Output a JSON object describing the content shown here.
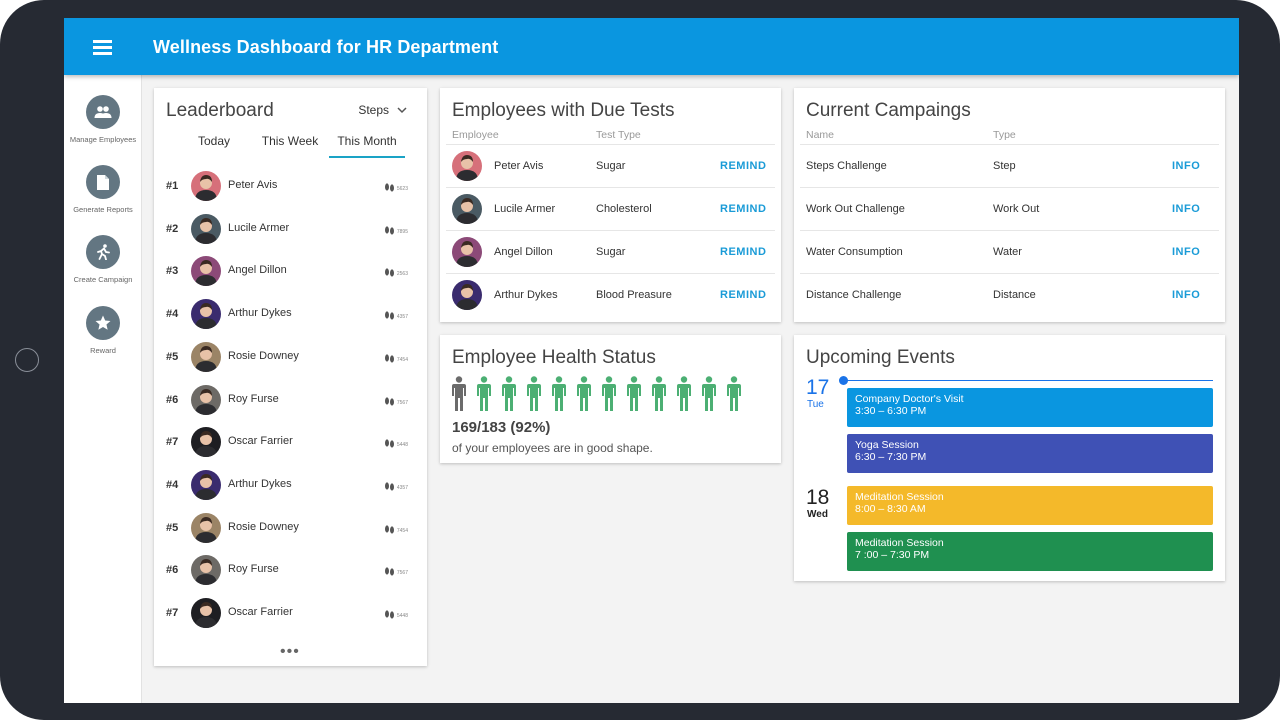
{
  "app": {
    "title": "Wellness Dashboard for HR Department"
  },
  "sidebar": {
    "items": [
      {
        "label": "Manage Employees",
        "icon": "people-icon"
      },
      {
        "label": "Generate Reports",
        "icon": "document-icon"
      },
      {
        "label": "Create Campaign",
        "icon": "running-icon"
      },
      {
        "label": "Reward",
        "icon": "star-icon"
      }
    ]
  },
  "leaderboard": {
    "title": "Leaderboard",
    "metric": "Steps",
    "tabs": [
      "Today",
      "This Week",
      "This Month"
    ],
    "active_tab": "This Month",
    "rows": [
      {
        "rank": "#1",
        "name": "Peter Avis",
        "steps": "5623"
      },
      {
        "rank": "#2",
        "name": "Lucile Armer",
        "steps": "7895"
      },
      {
        "rank": "#3",
        "name": "Angel Dillon",
        "steps": "2563"
      },
      {
        "rank": "#4",
        "name": "Arthur Dykes",
        "steps": "4357"
      },
      {
        "rank": "#5",
        "name": "Rosie Downey",
        "steps": "7454"
      },
      {
        "rank": "#6",
        "name": "Roy Furse",
        "steps": "7567"
      },
      {
        "rank": "#7",
        "name": "Oscar Farrier",
        "steps": "5448"
      },
      {
        "rank": "#4",
        "name": "Arthur Dykes",
        "steps": "4357"
      },
      {
        "rank": "#5",
        "name": "Rosie Downey",
        "steps": "7454"
      },
      {
        "rank": "#6",
        "name": "Roy Furse",
        "steps": "7567"
      },
      {
        "rank": "#7",
        "name": "Oscar Farrier",
        "steps": "5448"
      }
    ],
    "more": "•••"
  },
  "due_tests": {
    "title": "Employees with Due Tests",
    "col_employee": "Employee",
    "col_type": "Test Type",
    "rows": [
      {
        "name": "Peter Avis",
        "type": "Sugar",
        "action": "REMIND"
      },
      {
        "name": "Lucile Armer",
        "type": "Cholesterol",
        "action": "REMIND"
      },
      {
        "name": "Angel Dillon",
        "type": "Sugar",
        "action": "REMIND"
      },
      {
        "name": "Arthur Dykes",
        "type": "Blood Preasure",
        "action": "REMIND"
      }
    ]
  },
  "campaigns": {
    "title": "Current Campaings",
    "col_name": "Name",
    "col_type": "Type",
    "rows": [
      {
        "name": "Steps Challenge",
        "type": "Step",
        "action": "INFO"
      },
      {
        "name": "Work Out Challenge",
        "type": "Work Out",
        "action": "INFO"
      },
      {
        "name": "Water Consumption",
        "type": "Water",
        "action": "INFO"
      },
      {
        "name": "Distance Challenge",
        "type": "Distance",
        "action": "INFO"
      }
    ]
  },
  "health": {
    "title": "Employee Health Status",
    "stat": "169/183 (92%)",
    "subtitle": "of your employees are in good shape.",
    "good_fraction": 0.92,
    "figures_total": 12,
    "figures_good": 11,
    "colors": {
      "good": "#4caf73",
      "bad": "#6b6b6b"
    }
  },
  "events": {
    "title": "Upcoming Events",
    "days": [
      {
        "day": "17",
        "weekday": "Tue",
        "events": [
          {
            "title": "Company Doctor's Visit",
            "time": "3:30 – 6:30 PM",
            "color": "#0a96e0"
          },
          {
            "title": "Yoga Session",
            "time": "6:30 – 7:30 PM",
            "color": "#3f51b5"
          }
        ]
      },
      {
        "day": "18",
        "weekday": "Wed",
        "events": [
          {
            "title": "Meditation Session",
            "time": "8:00 – 8:30 AM",
            "color": "#f4b92a"
          },
          {
            "title": "Meditation Session",
            "time": "7 :00 – 7:30 PM",
            "color": "#1f9050"
          }
        ]
      }
    ]
  },
  "colors": {
    "appbar": "#0a96e0",
    "accent": "#1a9bd7",
    "sidebar_icon": "#637682",
    "today": "#1a73e8"
  }
}
